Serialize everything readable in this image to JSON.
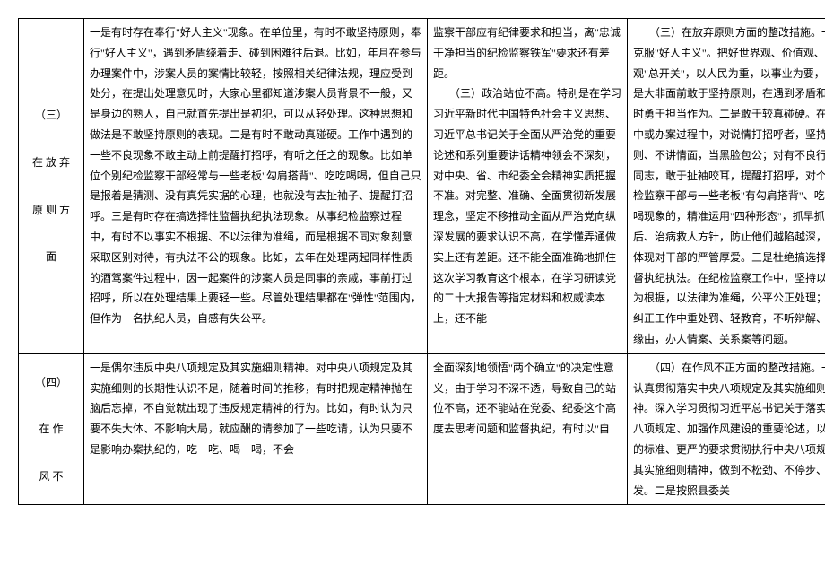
{
  "rows": [
    {
      "label": "（三）\n\n在 放 弃\n\n原 则 方\n\n面",
      "col1": "一是有时存在奉行\"好人主义\"现象。在单位里，有时不敢坚持原则，奉行\"好人主义\"，遇到矛盾绕着走、碰到困难往后退。比如，年月在参与办理案件中，涉案人员的案情比较轻，按照相关纪律法规，理应受到处分，在提出处理意见时，大家心里都知道涉案人员背景不一般，又是身边的熟人，自己就首先提出是初犯，可以从轻处理。这种思想和做法是不敢坚持原则的表现。二是有时不敢动真碰硬。工作中遇到的一些不良现象不敢主动上前提醒打招呼，有听之任之的现象。比如单位个别纪检监察干部经常与一些老板\"勾肩搭背\"、吃吃喝喝，但自己只是报着是猜测、没有真凭实据的心理，也就没有去扯袖子、提醒打招呼。三是有时存在搞选择性监督执纪执法现象。从事纪检监察过程中，有时不以事实不根据、不以法律为准绳，而是根据不同对象刻意采取区别对待，有执法不公的现象。比如，去年在处理两起同样性质的酒驾案件过程中，因一起案件的涉案人员是同事的亲戚，事前打过招呼，所以在处理结果上要轻一些。尽管处理结果都在\"弹性\"范围内，但作为一名执纪人员，自感有失公平。",
      "col2": "监察干部应有纪律要求和担当，离\"忠诚干净担当的纪检监察铁军\"要求还有差距。\n　　（三）政治站位不高。特别是在学习习近平新时代中国特色社会主义思想、习近平总书记关于全面从严治党的重要论述和系列重要讲话精神领会不深刻，对中央、省、市纪委全会精神实质把握不准。对完整、准确、全面贯彻新发展理念，坚定不移推动全面从严治党向纵深发展的要求认识不高，在学懂弄通做实上还有差距。还不能全面准确地抓住这次学习教育这个根本，在学习研读党的二十大报告等指定材料和权威读本上，还不能",
      "col3": "　　（三）在放弃原则方面的整改措施。一是克服\"好人主义\"。把好世界观、价值观、人生观\"总开关\"，以人民为重，以事业为要，在大是大非面前敢于坚持原则，在遇到矛盾和困难时勇于担当作为。二是敢于较真碰硬。在工作中或办案过程中，对说情打招呼者，坚持原则、不讲情面，当黑脸包公；对有不良行为的同志，敢于扯袖咬耳，提醒打招呼，对个别纪检监察干部与一些老板\"有勾肩搭背\"、吃吃喝喝现象的，精准运用\"四种形态\"，抓早抓前惩后、治病救人方针，防止他们越陷越深，充分体现对干部的严管厚爱。三是杜绝搞选择性监督执纪执法。在纪检监察工作中，坚持以事实为根据，以法律为准绳，公平公正处理；坚决纠正工作中重处罚、轻教育，不听辩解、不问缘由，办人情案、关系案等问题。"
    },
    {
      "label": "（四）\n\n在 作\n\n风 不",
      "col1": "一是偶尔违反中央八项规定及其实施细则精神。对中央八项规定及其实施细则的长期性认识不足，随着时间的推移，有时把规定精神抛在脑后忘掉，不自觉就出现了违反规定精神的行为。比如，有时认为只要不失大体、不影响大局，就应酬的请参加了一些吃请，认为只要不是影响办案执纪的，吃一吃、喝一喝，不会",
      "col2": "全面深刻地领悟\"两个确立\"的决定性意义，由于学习不深不透，导致自己的站位不高，还不能站在党委、纪委这个高度去思考问题和监督执纪，有时以\"自",
      "col3": "　　（四）在作风不正方面的整改措施。一是认真贯彻落实中央八项规定及其实施细则精神。深入学习贯彻习近平总书记关于落实中央八项规定、加强作风建设的重要论述，以更高的标准、更严的要求贯彻执行中央八项规定及其实施细则精神，做到不松劲、不停步、再出发。二是按照县委关"
    }
  ]
}
